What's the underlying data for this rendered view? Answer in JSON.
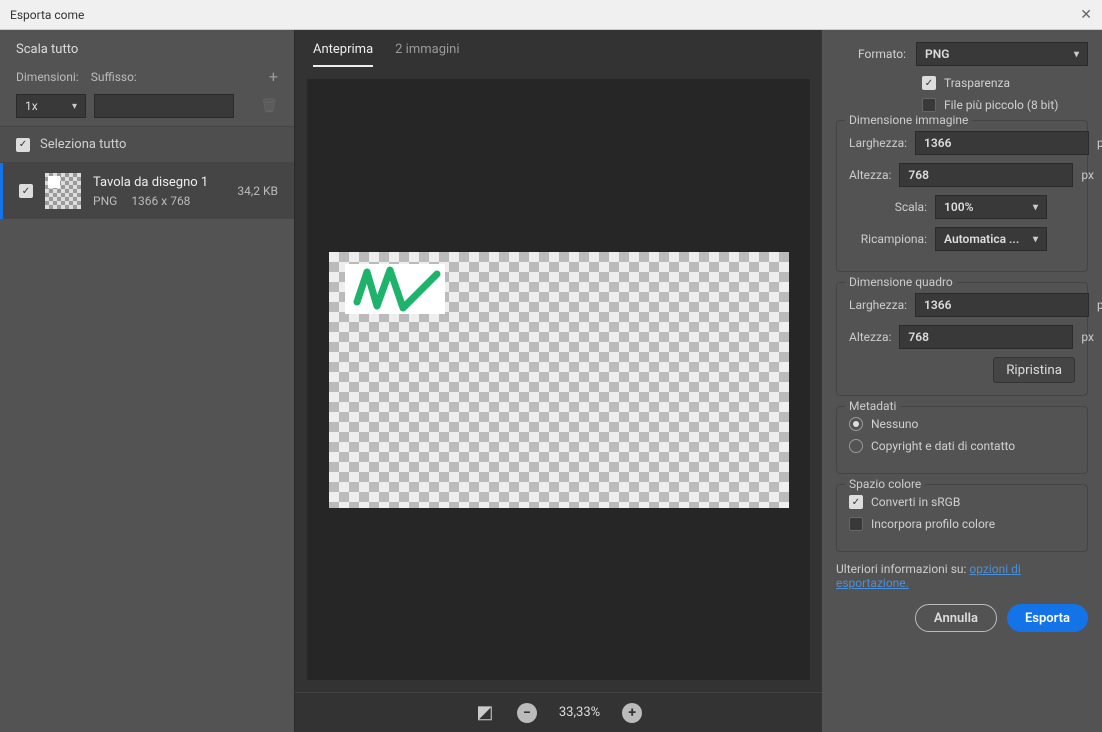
{
  "window": {
    "title": "Esporta come"
  },
  "left": {
    "scala_tutto": "Scala tutto",
    "dimensioni": "Dimensioni:",
    "suffisso": "Suffisso:",
    "scale_value": "1x",
    "select_all": "Seleziona tutto",
    "artboard": {
      "name": "Tavola da disegno 1",
      "format": "PNG",
      "dims": "1366 x 768",
      "size": "34,2 KB"
    }
  },
  "center": {
    "tabs": {
      "preview": "Anteprima",
      "two_up": "2 immagini"
    },
    "zoom": "33,33%"
  },
  "right": {
    "formato_label": "Formato:",
    "formato_value": "PNG",
    "trasparenza": "Trasparenza",
    "file_piccolo": "File più piccolo (8 bit)",
    "dim_img": {
      "legend": "Dimensione immagine",
      "larghezza_label": "Larghezza:",
      "larghezza_value": "1366",
      "altezza_label": "Altezza:",
      "altezza_value": "768",
      "scala_label": "Scala:",
      "scala_value": "100%",
      "ricampiona_label": "Ricampiona:",
      "ricampiona_value": "Automatica ...",
      "px": "px"
    },
    "dim_quadro": {
      "legend": "Dimensione quadro",
      "larghezza_label": "Larghezza:",
      "larghezza_value": "1366",
      "altezza_label": "Altezza:",
      "altezza_value": "768",
      "ripristina": "Ripristina",
      "px": "px"
    },
    "meta": {
      "legend": "Metadati",
      "nessuno": "Nessuno",
      "copyright": "Copyright e dati di contatto"
    },
    "colorspace": {
      "legend": "Spazio colore",
      "srgb": "Converti in sRGB",
      "embed": "Incorpora profilo colore"
    },
    "info_prefix": "Ulteriori informazioni su: ",
    "info_link": "opzioni di esportazione.",
    "cancel": "Annulla",
    "export": "Esporta"
  }
}
